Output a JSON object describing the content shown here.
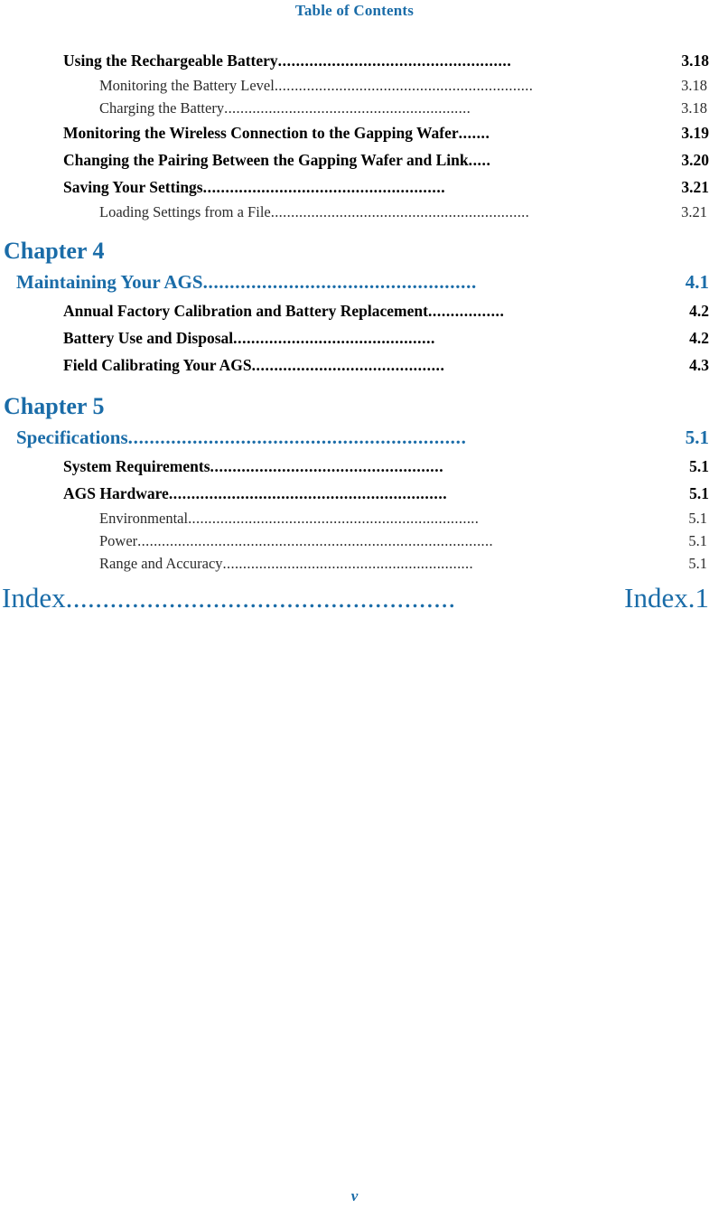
{
  "header": {
    "title": "Table of Contents"
  },
  "footer": {
    "folio": "v"
  },
  "colors": {
    "accent_blue": "#1a6ca8",
    "body_black": "#000000",
    "sub_entry_gray": "#2b2b2b",
    "page_background": "#ffffff"
  },
  "toc": {
    "entries": [
      {
        "level": 1,
        "title": "Using the Rechargeable Battery",
        "leader": "....................................................",
        "page": "3.18"
      },
      {
        "level": 2,
        "title": "Monitoring the Battery Level",
        "leader": "................................................................",
        "page": "3.18"
      },
      {
        "level": 2,
        "title": "Charging the Battery ",
        "leader": ".............................................................",
        "page": "3.18"
      },
      {
        "level": 1,
        "title": "Monitoring the Wireless Connection to the Gapping Wafer ",
        "leader": ".......",
        "page": "3.19"
      },
      {
        "level": 1,
        "title": "Changing the Pairing Between the Gapping Wafer and Link",
        "leader": ".....",
        "page": "3.20"
      },
      {
        "level": 1,
        "title": "Saving Your Settings",
        "leader": "......................................................",
        "page": "3.21"
      },
      {
        "level": 2,
        "title": "Loading Settings from a File",
        "leader": "................................................................",
        "page": "3.21"
      }
    ],
    "chapter4": {
      "label": "Chapter 4",
      "title": "Maintaining Your AGS ",
      "leader": "...................................................",
      "page": "4.1",
      "entries": [
        {
          "level": 1,
          "title": "Annual Factory Calibration and Battery Replacement ",
          "leader": ".................",
          "page": "4.2"
        },
        {
          "level": 1,
          "title": "Battery Use and Disposal ",
          "leader": ".............................................",
          "page": "4.2"
        },
        {
          "level": 1,
          "title": "Field Calibrating Your AGS",
          "leader": "...........................................",
          "page": "4.3"
        }
      ]
    },
    "chapter5": {
      "label": "Chapter 5",
      "title": "Specifications",
      "leader": "...............................................................",
      "page": "5.1",
      "entries": [
        {
          "level": 1,
          "title": "System Requirements ",
          "leader": "....................................................",
          "page": "5.1"
        },
        {
          "level": 1,
          "title": "AGS Hardware ",
          "leader": "..............................................................",
          "page": "5.1"
        },
        {
          "level": 2,
          "title": "Environmental ",
          "leader": "........................................................................",
          "page": "5.1"
        },
        {
          "level": 2,
          "title": "Power",
          "leader": "........................................................................................",
          "page": "5.1"
        },
        {
          "level": 2,
          "title": "Range and Accuracy",
          "leader": "..............................................................",
          "page": "5.1"
        }
      ]
    },
    "index": {
      "title": "Index",
      "leader": ".....................................................",
      "page": "Index.1"
    }
  }
}
